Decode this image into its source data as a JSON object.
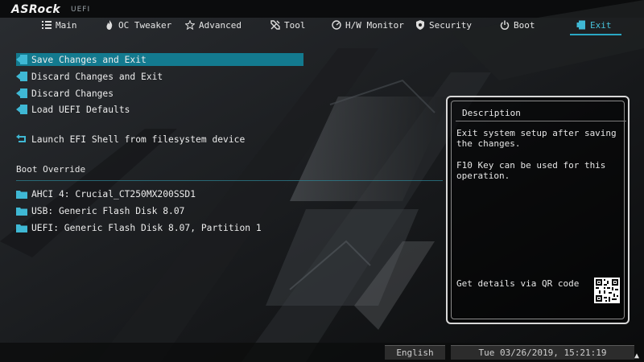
{
  "brand": {
    "logo": "ASRock",
    "sub": "UEFI"
  },
  "tabs": [
    {
      "label": "Main",
      "icon": "grid-icon"
    },
    {
      "label": "OC Tweaker",
      "icon": "flame-icon"
    },
    {
      "label": "Advanced",
      "icon": "star-icon"
    },
    {
      "label": "Tool",
      "icon": "wrench-icon"
    },
    {
      "label": "H/W Monitor",
      "icon": "monitor-gauge-icon"
    },
    {
      "label": "Security",
      "icon": "shield-icon"
    },
    {
      "label": "Boot",
      "icon": "power-icon"
    },
    {
      "label": "Exit",
      "icon": "exit-door-icon"
    }
  ],
  "active_tab": "Exit",
  "menu": {
    "items": [
      {
        "label": "Save Changes and Exit",
        "icon": "exit-door-icon"
      },
      {
        "label": "Discard Changes and Exit",
        "icon": "exit-door-icon"
      },
      {
        "label": "Discard Changes",
        "icon": "exit-door-icon"
      },
      {
        "label": "Load UEFI Defaults",
        "icon": "exit-door-icon"
      },
      {
        "label": "Launch EFI Shell from filesystem device",
        "icon": "refresh-arrow-icon"
      }
    ],
    "boot_override_title": "Boot Override",
    "boot_items": [
      {
        "label": "AHCI 4: Crucial_CT250MX200SSD1",
        "icon": "folder-icon"
      },
      {
        "label": "USB: Generic Flash Disk 8.07",
        "icon": "folder-icon"
      },
      {
        "label": "UEFI: Generic Flash Disk 8.07, Partition 1",
        "icon": "folder-icon"
      }
    ]
  },
  "description": {
    "title": "Description",
    "line1": "Exit system setup after saving the changes.",
    "line2": "F10 Key can be used for this operation.",
    "qr_label": "Get details via QR code"
  },
  "footer": {
    "language": "English",
    "datetime": "Tue 03/26/2019, 15:21:19"
  },
  "colors": {
    "accent": "#2aa7c3",
    "selected": "#137a8f",
    "icon": "#3fb8d4"
  }
}
